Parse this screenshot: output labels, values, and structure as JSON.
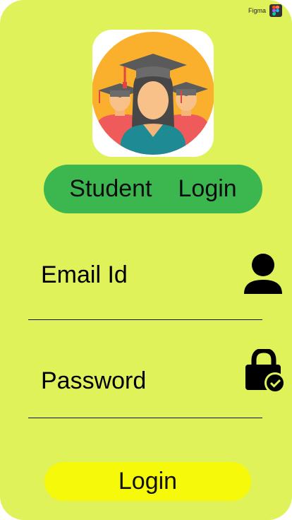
{
  "figma_badge": {
    "label": "Figma"
  },
  "header": {
    "title_word_1": "Student",
    "title_word_2": "Login"
  },
  "form": {
    "email_placeholder": "Email Id",
    "password_placeholder": "Password"
  },
  "actions": {
    "login_label": "Login"
  },
  "colors": {
    "background": "#dff25a",
    "title_pill": "#3cb64f",
    "login_button": "#f6f90a"
  },
  "icons": {
    "app_logo": "graduates-avatar-icon",
    "email": "person-icon",
    "password": "lock-check-icon",
    "figma": "figma-icon"
  }
}
